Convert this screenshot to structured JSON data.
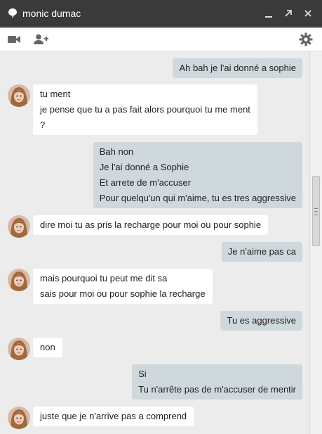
{
  "window": {
    "title": "monic dumac",
    "accent_color": "#4fbf3c",
    "titlebar_color": "#3a3a3a"
  },
  "icons": {
    "chat": "speech-bubble-icon",
    "minimize": "minimize-icon",
    "popout": "popout-arrow-icon",
    "close": "close-icon",
    "video": "video-camera-icon",
    "add_person": "add-person-icon",
    "settings": "gear-icon"
  },
  "messages": [
    {
      "direction": "out",
      "lines": [
        "Ah bah je l'ai donné a sophie"
      ]
    },
    {
      "direction": "in",
      "lines": [
        "tu ment",
        "je pense que tu a pas fait alors pourquoi tu me ment",
        "?"
      ]
    },
    {
      "direction": "out",
      "lines": [
        "Bah non",
        "Je l'ai donné a Sophie",
        "Et arrete de m'accuser",
        "Pour quelqu'un qui m'aime, tu es tres aggressive"
      ]
    },
    {
      "direction": "in",
      "lines": [
        "dire moi tu as pris la recharge pour moi ou pour sophie"
      ]
    },
    {
      "direction": "out",
      "lines": [
        "Je n'aime pas ca"
      ]
    },
    {
      "direction": "in",
      "lines": [
        "mais pourquoi tu peut me dit sa",
        "sais pour moi ou pour sophie la recharge"
      ]
    },
    {
      "direction": "out",
      "lines": [
        "Tu es aggressive"
      ]
    },
    {
      "direction": "in",
      "lines": [
        "non"
      ]
    },
    {
      "direction": "out",
      "lines": [
        "Si",
        "Tu n'arrête pas de m'accuser de mentir"
      ]
    },
    {
      "direction": "in",
      "lines": [
        "juste que je n'arrive pas a comprend"
      ]
    }
  ]
}
